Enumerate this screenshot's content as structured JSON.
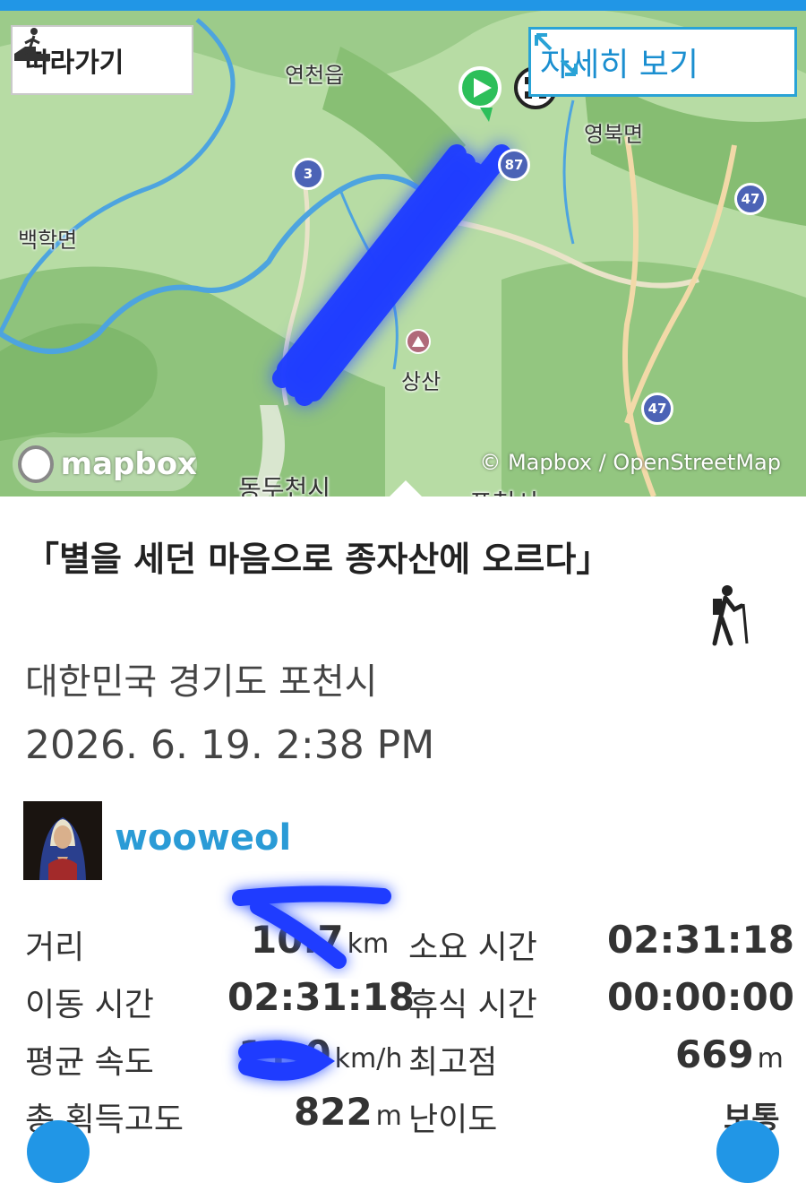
{
  "header": {
    "accent_color": "#2196e6"
  },
  "map": {
    "follow_label": "따라가기",
    "detail_label": "자세히 보기",
    "place_labels": {
      "yeoncheon": "연천읍",
      "yeongbuk": "영북면",
      "baekhak": "백학면",
      "sangsan": "상산",
      "dongducheon": "동두천시",
      "pocheon": "포천시"
    },
    "route_numbers": {
      "r3": "3",
      "r87": "87",
      "r47a": "47",
      "r47b": "47"
    },
    "logo_text": "mapbox",
    "attribution": "© Mapbox / OpenStreetMap",
    "track_color": "#1f3cff"
  },
  "activity": {
    "title": "「별을 세던 마음으로 종자산에 오르다」",
    "location": "대한민국 경기도 포천시",
    "datetime": "2026. 6. 19. 2:38 PM",
    "username": "wooweol",
    "activity_icon": "hiker-icon"
  },
  "stats": {
    "distance_label": "거리",
    "distance_value": "10.7",
    "distance_unit": "km",
    "duration_label": "소요 시간",
    "duration_value": "02:31:18",
    "moving_time_label": "이동 시간",
    "moving_time_value": "02:31:18",
    "rest_time_label": "휴식 시간",
    "rest_time_value": "00:00:00",
    "avg_speed_label": "평균 속도",
    "avg_speed_value": "11.0",
    "avg_speed_unit": "km/h",
    "max_alt_label": "최고점",
    "max_alt_value": "669",
    "max_alt_unit": "m",
    "total_ascent_label": "총 획득고도",
    "total_ascent_value": "822",
    "total_ascent_unit": "m",
    "difficulty_label": "난이도",
    "difficulty_value": "보통"
  }
}
